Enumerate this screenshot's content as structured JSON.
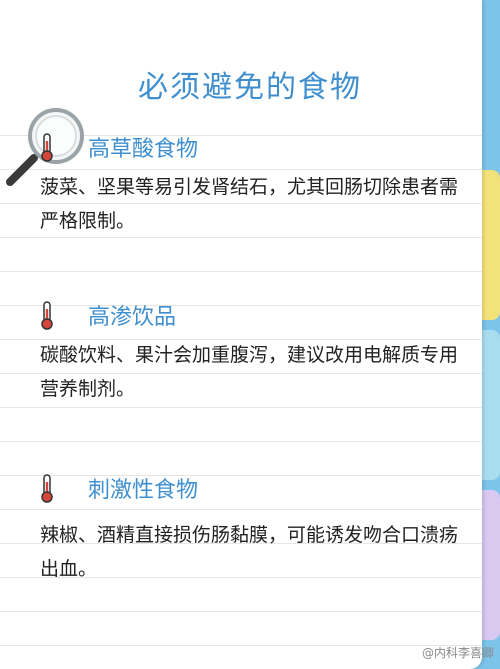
{
  "title": "必须避免的食物",
  "sections": [
    {
      "heading": "高草酸食物",
      "body": "菠菜、坚果等易引发肾结石，尤其回肠切除患者需严格限制。"
    },
    {
      "heading": "高渗饮品",
      "body": "碳酸饮料、果汁会加重腹泻，建议改用电解质专用营养制剂。"
    },
    {
      "heading": "刺激性食物",
      "body": "辣椒、酒精直接损伤肠黏膜，可能诱发吻合口溃疡出血。"
    }
  ],
  "watermark": "@内科李喜卿",
  "colors": {
    "title": "#3f8fcf",
    "frame": "#7cc4ea",
    "thermometer": "#d6453c"
  }
}
